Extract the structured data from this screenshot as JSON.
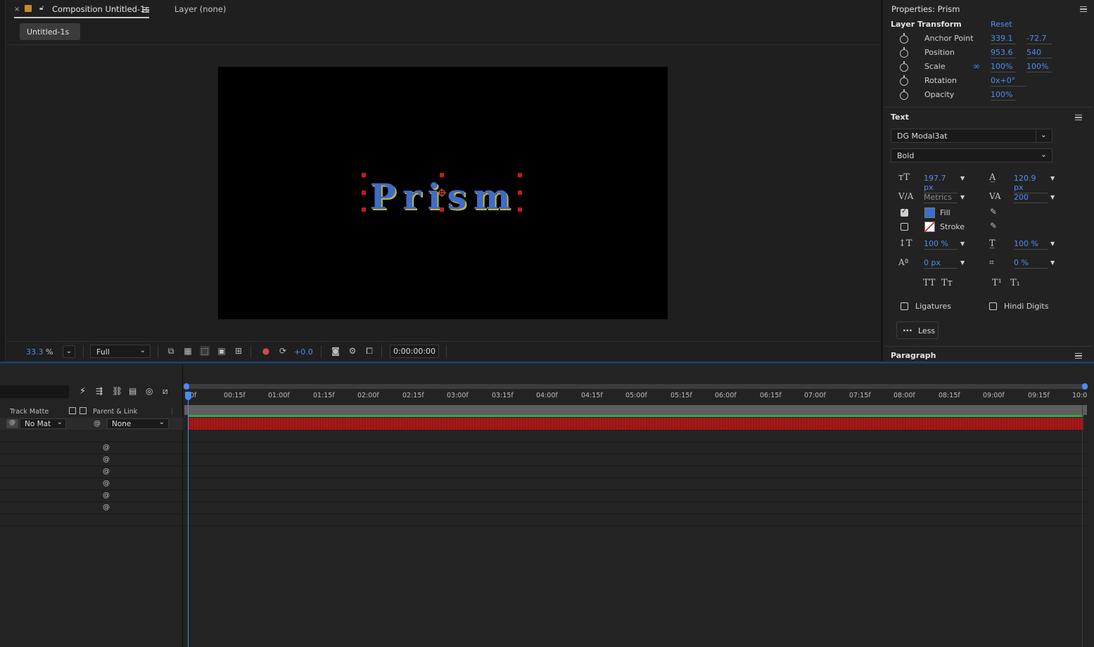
{
  "composition_panel": {
    "tab_title": "Composition Untitled-1s",
    "layer_tab": "Layer (none)",
    "chip_label": "Untitled-1s",
    "canvas_text": "Prism",
    "bottom_bar": {
      "zoom_value": "33.3",
      "zoom_unit": "%",
      "resolution": "Full",
      "exposure": "+0.0",
      "timecode": "0:00:00:00"
    }
  },
  "properties": {
    "title": "Properties: Prism",
    "layer_transform": {
      "heading": "Layer Transform",
      "reset_label": "Reset",
      "rows": [
        {
          "label": "Anchor Point",
          "v1": "339.1",
          "v2": "-72.7"
        },
        {
          "label": "Position",
          "v1": "953.6",
          "v2": "540"
        },
        {
          "label": "Scale",
          "v1": "100%",
          "v2": "100%"
        },
        {
          "label": "Rotation",
          "v1": "0x+0°",
          "v2": ""
        },
        {
          "label": "Opacity",
          "v1": "100%",
          "v2": ""
        }
      ]
    },
    "text": {
      "heading": "Text",
      "font_family": "DG Modal3at",
      "font_style": "Bold",
      "font_size": "197.7 px",
      "leading": "120.9 px",
      "kerning": "Metrics",
      "tracking": "200",
      "fill_label": "Fill",
      "stroke_label": "Stroke",
      "fill_color": "#3a6fd0",
      "vert_scale": "100 %",
      "horiz_scale": "100 %",
      "baseline_shift": "0 px",
      "tsume": "0 %",
      "caps_all": "TT",
      "caps_small": "Tт",
      "superscript": "T¹",
      "subscript": "T₁",
      "ligatures_label": "Ligatures",
      "hindi_digits_label": "Hindi Digits",
      "less_label": "Less",
      "less_icon": "..."
    },
    "paragraph_heading": "Paragraph"
  },
  "timeline": {
    "headers": {
      "track_matte": "Track Matte",
      "parent_link": "Parent & Link"
    },
    "layer": {
      "matte_value": "No Mat",
      "parent_value": "None"
    },
    "ruler_ticks": [
      "0f",
      "00:15f",
      "01:00f",
      "01:15f",
      "02:00f",
      "02:15f",
      "03:00f",
      "03:15f",
      "04:00f",
      "04:15f",
      "05:00f",
      "05:15f",
      "06:00f",
      "06:15f",
      "07:00f",
      "07:15f",
      "08:00f",
      "08:15f",
      "09:00f",
      "09:15f",
      "10:0"
    ]
  }
}
